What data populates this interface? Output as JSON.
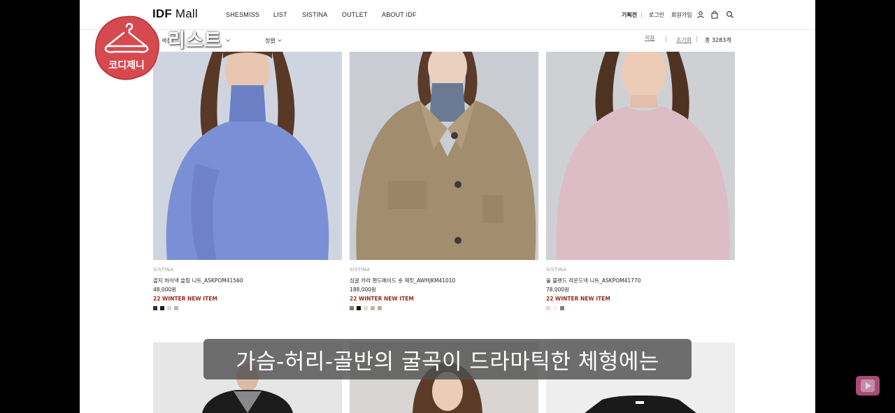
{
  "header": {
    "logo_bold": "IDF",
    "logo_rest": " Mall",
    "nav": [
      "SHESMISS",
      "LIST",
      "SISTINA",
      "OUTLET",
      "ABOUT IDF"
    ],
    "util": {
      "special": "기획전",
      "login": "로그인",
      "signup": "회원가입"
    },
    "separator": "|"
  },
  "filters": {
    "color_label": "색상",
    "sort_label": "정렬",
    "apply": "적용",
    "reset": "초기화",
    "count": "총 3283개"
  },
  "products": [
    {
      "brand": "SISTINA",
      "name": "골지 하이넥 슬림 니트_ASKPOM41560",
      "price": "48,000원",
      "tag": "22 WINTER NEW ITEM",
      "swatches": [
        "#2b3148",
        "#1d1d24",
        "#ddd6c8",
        "#b9b9b9"
      ]
    },
    {
      "brand": "SISTINA",
      "name": "싱글 카라 핸드메이드 숏 재킷_AWHJKM41010",
      "price": "188,000원",
      "tag": "22 WINTER NEW ITEM",
      "swatches": [
        "#8b7b6b",
        "#111111",
        "#e8dccb",
        "#c6b98e",
        "#d2a3a0"
      ]
    },
    {
      "brand": "SISTINA",
      "name": "울 블렌드 라운드넥 니트_ASKPOM41770",
      "price": "78,000원",
      "tag": "22 WINTER NEW ITEM",
      "swatches": [
        "#f2d2d8",
        "#f5f1ea",
        "#6f8a86"
      ]
    }
  ],
  "overlay": {
    "sticker_text": "코디제니",
    "title": "리스트",
    "caption": "가슴-허리-골반의 굴곡이 드라마틱한 체형에는"
  },
  "colors": {
    "tag": "#9a2b1c",
    "sticker": "#d64a4f"
  }
}
